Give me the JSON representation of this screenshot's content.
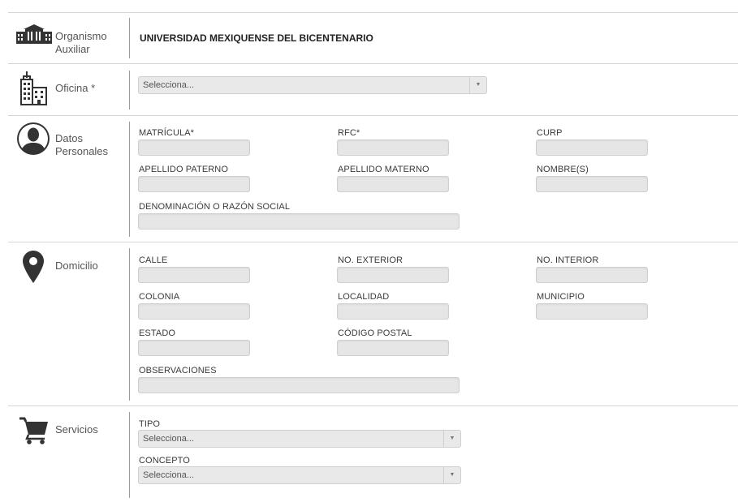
{
  "organismo": {
    "label": "Organismo\nAuxiliar",
    "icon": "building-bank-icon",
    "value": "UNIVERSIDAD MEXIQUENSE DEL BICENTENARIO"
  },
  "oficina": {
    "label": "Oficina *",
    "icon": "office-buildings-icon",
    "select_value": "Selecciona..."
  },
  "datos_personales": {
    "label": "Datos\nPersonales",
    "icon": "user-avatar-icon",
    "fields": {
      "matricula": "MATRÍCULA*",
      "rfc": "RFC*",
      "curp": "CURP",
      "apellido_paterno": "APELLIDO PATERNO",
      "apellido_materno": "APELLIDO MATERNO",
      "nombre": "NOMBRE(S)",
      "razon_social": "DENOMINACIÓN O RAZÓN SOCIAL"
    }
  },
  "domicilio": {
    "label": "Domicilio",
    "icon": "map-pin-icon",
    "fields": {
      "calle": "CALLE",
      "no_exterior": "NO. EXTERIOR",
      "no_interior": "NO. INTERIOR",
      "colonia": "COLONIA",
      "localidad": "LOCALIDAD",
      "municipio": "MUNICIPIO",
      "estado": "ESTADO",
      "codigo_postal": "CÓDIGO POSTAL",
      "observaciones": "OBSERVACIONES"
    }
  },
  "servicios": {
    "label": "Servicios",
    "icon": "shopping-cart-icon",
    "tipo_label": "TIPO",
    "tipo_value": "Selecciona...",
    "concepto_label": "CONCEPTO",
    "concepto_value": "Selecciona..."
  },
  "colors": {
    "divider": "#d6d6d6",
    "input_bg": "#e6e6e6",
    "icon": "#333333"
  }
}
